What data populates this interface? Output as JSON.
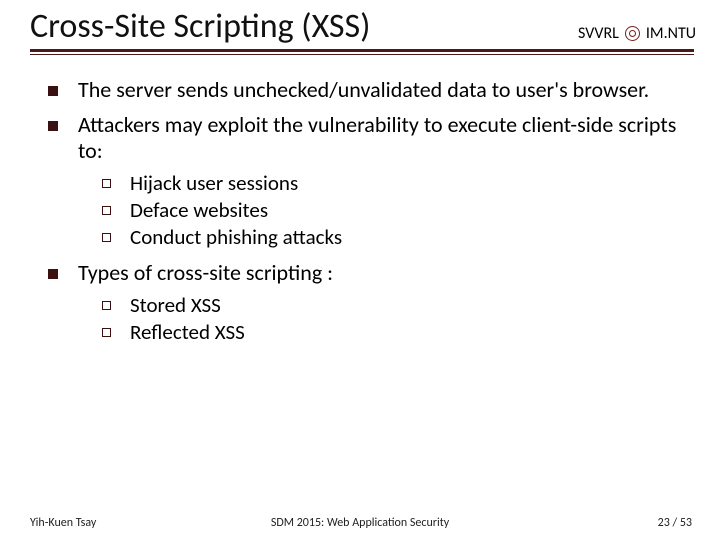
{
  "header": {
    "title": "Cross-Site Scripting (XSS)",
    "org_left": "SVVRL",
    "org_right": "IM.NTU"
  },
  "bullets": [
    {
      "text": "The server sends unchecked/unvalidated data to user's browser.",
      "subs": []
    },
    {
      "text": "Attackers may exploit the vulnerability to execute client-side scripts to:",
      "subs": [
        "Hijack user sessions",
        "Deface websites",
        "Conduct phishing attacks"
      ]
    },
    {
      "text": "Types of cross-site scripting :",
      "subs": [
        "Stored XSS",
        "Reflected XSS"
      ]
    }
  ],
  "footer": {
    "author": "Yih-Kuen Tsay",
    "center": "SDM 2015: Web Application Security",
    "page": "23 / 53"
  }
}
